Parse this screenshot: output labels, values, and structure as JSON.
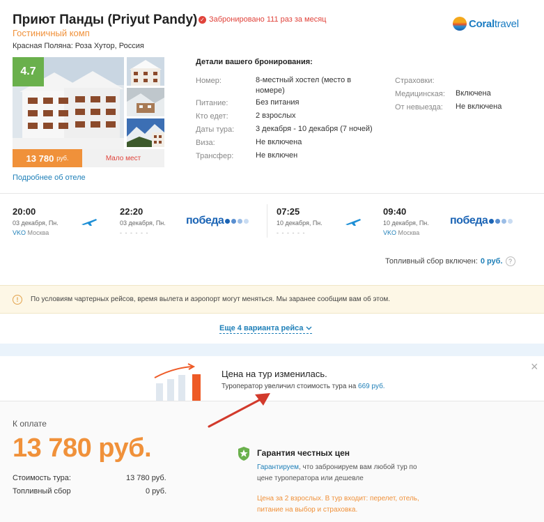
{
  "hotel": {
    "name": "Приют Панды (Priyut Pandy)",
    "booked_text": "Забронировано 111 раз за месяц",
    "type": "Гостиничный комп",
    "location": "Красная Поляна: Роза Хутор, Россия",
    "rating": "4.7",
    "price_value": "13 780",
    "price_currency": "руб.",
    "few_places": "Мало мест",
    "more_link": "Подробнее об отеле"
  },
  "logo": {
    "part1": "Coral",
    "part2": "travel"
  },
  "booking": {
    "title": "Детали вашего бронирования:",
    "left": [
      {
        "label": "Номер:",
        "value": "8-местный хостел (место в номере)"
      },
      {
        "label": "Питание:",
        "value": "Без питания"
      },
      {
        "label": "Кто едет:",
        "value": "2 взрослых"
      },
      {
        "label": "Даты тура:",
        "value": "3 декабря - 10 декабря (7 ночей)"
      },
      {
        "label": "Виза:",
        "value": "Не включена"
      },
      {
        "label": "Трансфер:",
        "value": "Не включен"
      }
    ],
    "right": [
      {
        "label": "Страховки:",
        "value": ""
      },
      {
        "label": "Медицинская:",
        "value": "Включена"
      },
      {
        "label": "От невыезда:",
        "value": "Не включена"
      }
    ]
  },
  "flights": {
    "outbound": {
      "dep_time": "20:00",
      "dep_date": "03 декабря, Пн.",
      "dep_code": "VKO",
      "dep_city": "Москва",
      "arr_time": "22:20",
      "arr_date": "03 декабря, Пн.",
      "arr_placeholder": "- - - - - -",
      "airline": "победа"
    },
    "return": {
      "dep_time": "07:25",
      "dep_date": "10 декабря, Пн.",
      "dep_placeholder": "- - - - - -",
      "arr_time": "09:40",
      "arr_date": "10 декабря, Пн.",
      "arr_code": "VKO",
      "arr_city": "Москва",
      "airline": "победа"
    },
    "fuel_label": "Топливный сбор включен:",
    "fuel_value": "0 руб.",
    "help": "?"
  },
  "warning": {
    "icon": "!",
    "text": "По условиям чартерных рейсов, время вылета и аэропорт могут меняться. Мы заранее сообщим вам об этом."
  },
  "more_flights": "Еще 4 варианта рейса",
  "price_change": {
    "title": "Цена на тур изменилась.",
    "sub_prefix": "Туроператор увеличил стоимость тура на",
    "sub_value": "669 руб.",
    "close": "×"
  },
  "payment": {
    "label": "К оплате",
    "total": "13 780 руб.",
    "rows": [
      {
        "label": "Стоимость тура:",
        "value": "13 780 руб."
      },
      {
        "label": "Топливный сбор",
        "value": "0 руб."
      }
    ]
  },
  "guarantee": {
    "title": "Гарантия честных цен",
    "link": "Гарантируем",
    "text": ", что забронируем вам любой тур по цене туроператора или дешевле",
    "note": "Цена за 2 взрослых. В тур входит: перелет, отель, питание на выбор и страховка."
  },
  "colors": {
    "accent": "#f0913a",
    "link": "#1e7fb8",
    "alert": "#e0433b",
    "rating": "#6ab04c",
    "airline": "#1b64b5"
  }
}
